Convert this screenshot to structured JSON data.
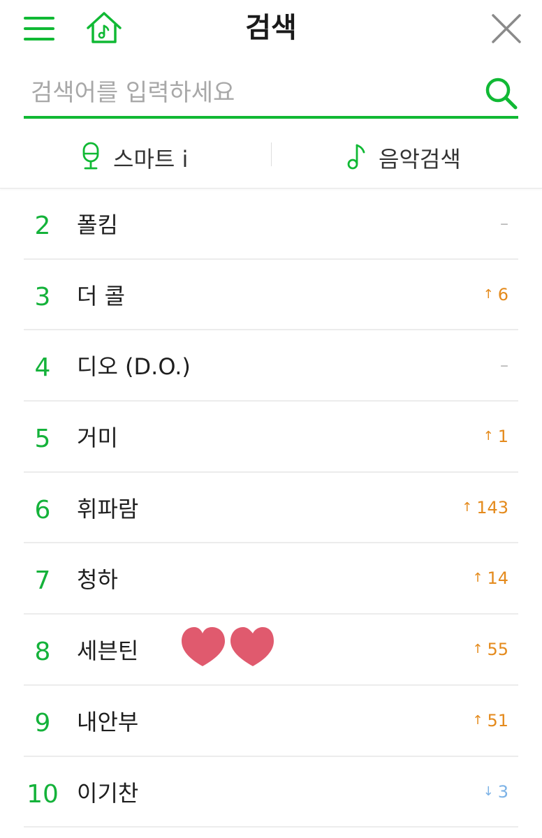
{
  "header": {
    "title": "검색",
    "menu_icon": "hamburger-menu-icon",
    "home_icon": "music-home-icon",
    "close_icon": "close-icon"
  },
  "search": {
    "placeholder": "검색어를 입력하세요",
    "value": "",
    "search_icon": "search-icon"
  },
  "modes": {
    "smart": {
      "label": "스마트 i",
      "icon": "microphone-icon"
    },
    "music": {
      "label": "음악검색",
      "icon": "music-note-icon"
    }
  },
  "colors": {
    "accent": "#10b934",
    "rank": "#14b23a",
    "up": "#e48a1c",
    "down": "#7cb2e6",
    "same": "#b8b8b8",
    "heart": "#e05a6e"
  },
  "ranking": [
    {
      "rank": "2",
      "name": "폴킴",
      "direction": "same",
      "arrow": "",
      "change": "–"
    },
    {
      "rank": "3",
      "name": "더 콜",
      "direction": "up",
      "arrow": "↑",
      "change": "6"
    },
    {
      "rank": "4",
      "name": "디오 (D.O.)",
      "direction": "same",
      "arrow": "",
      "change": "–"
    },
    {
      "rank": "5",
      "name": "거미",
      "direction": "up",
      "arrow": "↑",
      "change": "1"
    },
    {
      "rank": "6",
      "name": "휘파람",
      "direction": "up",
      "arrow": "↑",
      "change": "143"
    },
    {
      "rank": "7",
      "name": "청하",
      "direction": "up",
      "arrow": "↑",
      "change": "14"
    },
    {
      "rank": "8",
      "name": "세븐틴",
      "direction": "up",
      "arrow": "↑",
      "change": "55"
    },
    {
      "rank": "9",
      "name": "내안부",
      "direction": "up",
      "arrow": "↑",
      "change": "51"
    },
    {
      "rank": "10",
      "name": "이기찬",
      "direction": "down",
      "arrow": "↓",
      "change": "3"
    }
  ]
}
